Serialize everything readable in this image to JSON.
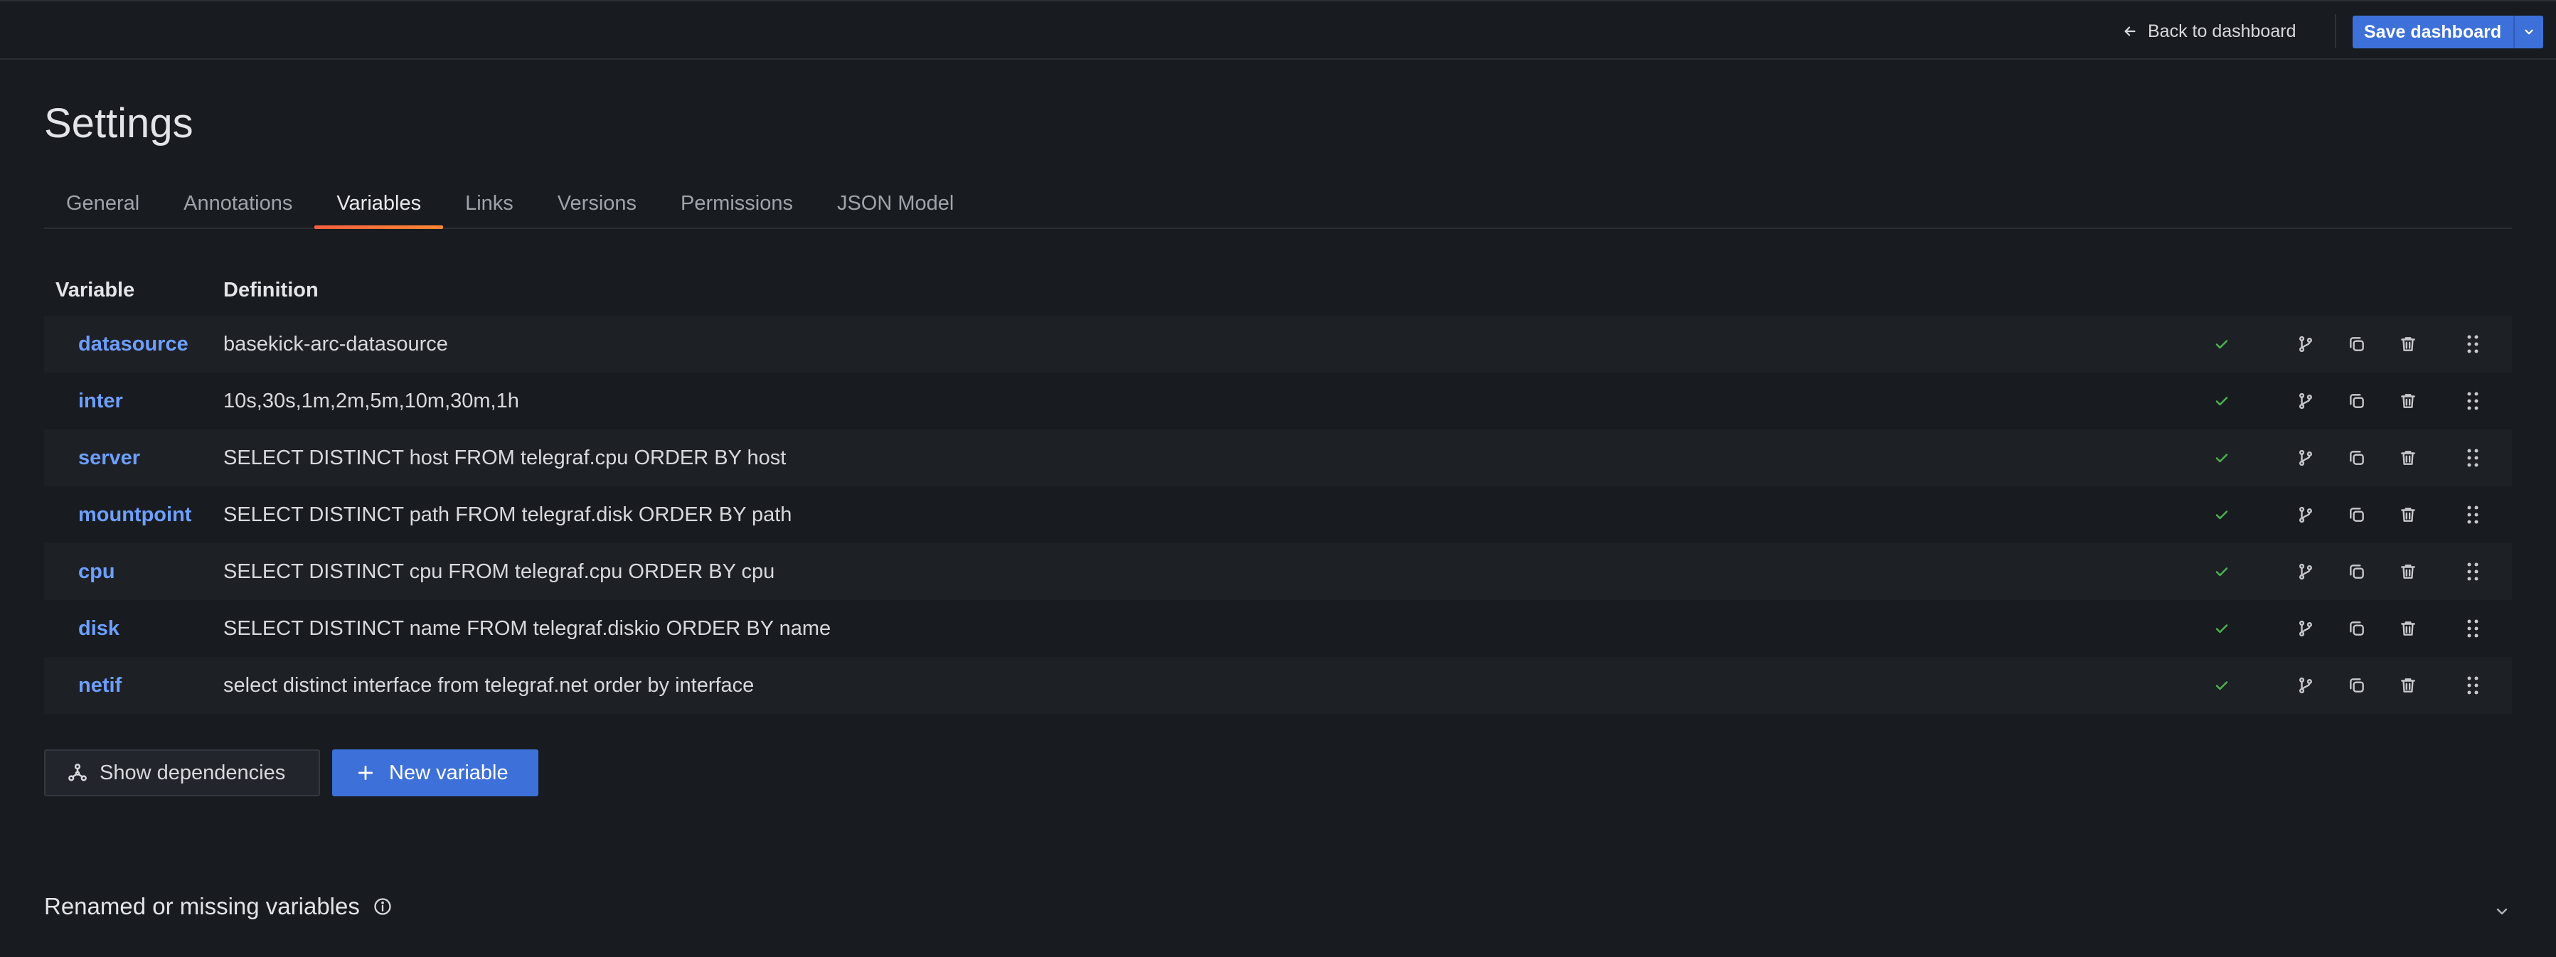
{
  "topbar": {
    "back_label": "Back to dashboard",
    "save_label": "Save dashboard"
  },
  "page": {
    "title": "Settings"
  },
  "tabs": [
    {
      "label": "General",
      "active": false
    },
    {
      "label": "Annotations",
      "active": false
    },
    {
      "label": "Variables",
      "active": true
    },
    {
      "label": "Links",
      "active": false
    },
    {
      "label": "Versions",
      "active": false
    },
    {
      "label": "Permissions",
      "active": false
    },
    {
      "label": "JSON Model",
      "active": false
    }
  ],
  "table": {
    "headers": {
      "variable": "Variable",
      "definition": "Definition"
    },
    "rows": [
      {
        "name": "datasource",
        "definition": "basekick-arc-datasource"
      },
      {
        "name": "inter",
        "definition": "10s,30s,1m,2m,5m,10m,30m,1h"
      },
      {
        "name": "server",
        "definition": "SELECT DISTINCT host FROM telegraf.cpu ORDER BY host"
      },
      {
        "name": "mountpoint",
        "definition": "SELECT DISTINCT path FROM telegraf.disk ORDER BY path"
      },
      {
        "name": "cpu",
        "definition": "SELECT DISTINCT cpu FROM telegraf.cpu ORDER BY cpu"
      },
      {
        "name": "disk",
        "definition": "SELECT DISTINCT name FROM telegraf.diskio ORDER BY name"
      },
      {
        "name": "netif",
        "definition": "select distinct interface from telegraf.net order by interface"
      }
    ]
  },
  "actions": {
    "show_dependencies": "Show dependencies",
    "new_variable": "New variable"
  },
  "renamed": {
    "title": "Renamed or missing variables"
  },
  "icons": {
    "back": "arrow-left-icon",
    "save_dropdown": "chevron-down-icon",
    "status": "check-icon",
    "row_actions": [
      "branch-icon",
      "duplicate-icon",
      "trash-icon"
    ],
    "drag": "drag-handle-icon",
    "dependencies": "graph-icon",
    "new": "plus-icon",
    "info": "info-circle-icon",
    "collapse": "chevron-down-icon"
  },
  "colors": {
    "background": "#181b1f",
    "row_alt": "#1d2025",
    "link": "#6e9fff",
    "primary": "#3d71d9",
    "check": "#4caf50",
    "tab_underline": "#f55f3e"
  }
}
